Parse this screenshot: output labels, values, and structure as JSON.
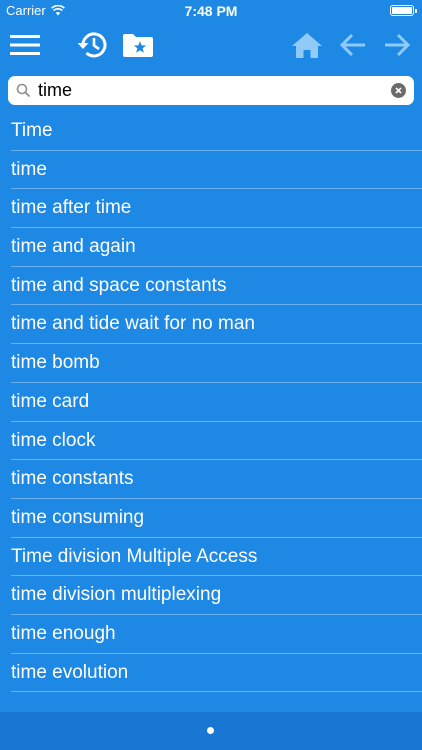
{
  "status_bar": {
    "carrier": "Carrier",
    "time": "7:48 PM"
  },
  "toolbar": {
    "icons": [
      "menu-icon",
      "history-icon",
      "favorites-folder-icon",
      "home-icon",
      "back-arrow-icon",
      "forward-arrow-icon"
    ]
  },
  "search": {
    "value": "time",
    "placeholder": ""
  },
  "results": [
    "Time",
    "time",
    "time after time",
    "time and again",
    "time and space constants",
    "time and tide wait for no man",
    "time bomb",
    "time card",
    "time clock",
    "time constants",
    "time consuming",
    "Time division Multiple Access",
    "time division multiplexing",
    "time enough",
    "time evolution"
  ],
  "colors": {
    "background": "#1e88e5",
    "bottom_bar": "#1976d2",
    "disabled_icon": "#90caf9"
  }
}
